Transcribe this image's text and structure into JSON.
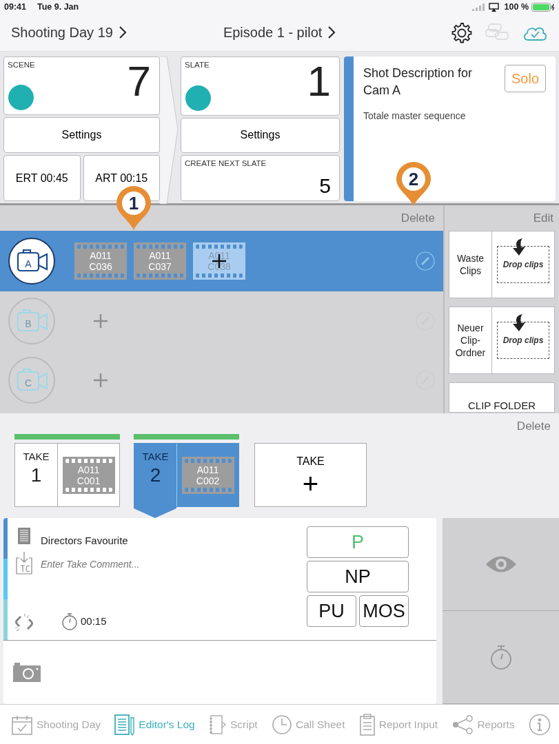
{
  "status_bar": {
    "time": "09:41",
    "date": "Tue 9. Jan",
    "battery": "100 %"
  },
  "header": {
    "shooting_day": "Shooting Day 19",
    "episode": "Episode 1 - pilot"
  },
  "scene": {
    "label": "SCENE",
    "number": "7",
    "color": "#20b0b2",
    "settings": "Settings",
    "ert": "ERT 00:45",
    "art": "ART 00:15"
  },
  "slate": {
    "label": "SLATE",
    "number": "1",
    "color": "#20b0b2",
    "settings": "Settings",
    "next_label": "CREATE NEXT SLATE",
    "next_number": "5"
  },
  "shot": {
    "title": "Shot Description for Cam A",
    "solo": "Solo",
    "description": "Totale master sequence"
  },
  "markers": [
    {
      "label": "1"
    },
    {
      "label": "2"
    }
  ],
  "cameras": {
    "delete": "Delete",
    "rows": [
      {
        "letter": "A",
        "selected": true,
        "clips": [
          {
            "kind": "clip",
            "name": "A011 C036"
          },
          {
            "kind": "clip",
            "name": "A011 C037"
          },
          {
            "kind": "add",
            "name": "A011 C038"
          }
        ]
      },
      {
        "letter": "B",
        "selected": false,
        "clips": [
          {
            "kind": "add"
          }
        ]
      },
      {
        "letter": "C",
        "selected": false,
        "clips": [
          {
            "kind": "add"
          }
        ]
      }
    ]
  },
  "clip_panel": {
    "edit": "Edit",
    "folders": [
      {
        "kind": "drop",
        "label": "Waste Clips",
        "drop": "Drop clips"
      },
      {
        "kind": "drop",
        "label": "Neuer Clip-Ordner",
        "drop": "Drop clips"
      },
      {
        "kind": "folder",
        "label": "CLIP FOLDER"
      }
    ]
  },
  "takes": {
    "delete": "Delete",
    "items": [
      {
        "kind": "take",
        "label": "TAKE",
        "number": "1",
        "clip": "A011 C001",
        "selected": false,
        "good": true
      },
      {
        "kind": "take",
        "label": "TAKE",
        "number": "2",
        "clip": "A011 C002",
        "selected": true,
        "good": true
      },
      {
        "kind": "new",
        "label": "TAKE",
        "number": "+"
      }
    ]
  },
  "take_detail": {
    "title": "Directors Favourite",
    "comment_placeholder": "Enter Take Comment...",
    "duration": "00:15",
    "flags": [
      {
        "label": "P",
        "selected": true
      },
      {
        "label": "NP",
        "selected": false
      },
      {
        "label": "PU",
        "selected": false
      },
      {
        "label": "MOS",
        "selected": false
      }
    ]
  },
  "tab_bar": [
    {
      "label": "Shooting Day",
      "selected": false
    },
    {
      "label": "Editor's Log",
      "selected": true
    },
    {
      "label": "Script",
      "selected": false
    },
    {
      "label": "Call Sheet",
      "selected": false
    },
    {
      "label": "Report Input",
      "selected": false
    },
    {
      "label": "Reports",
      "selected": false
    }
  ]
}
